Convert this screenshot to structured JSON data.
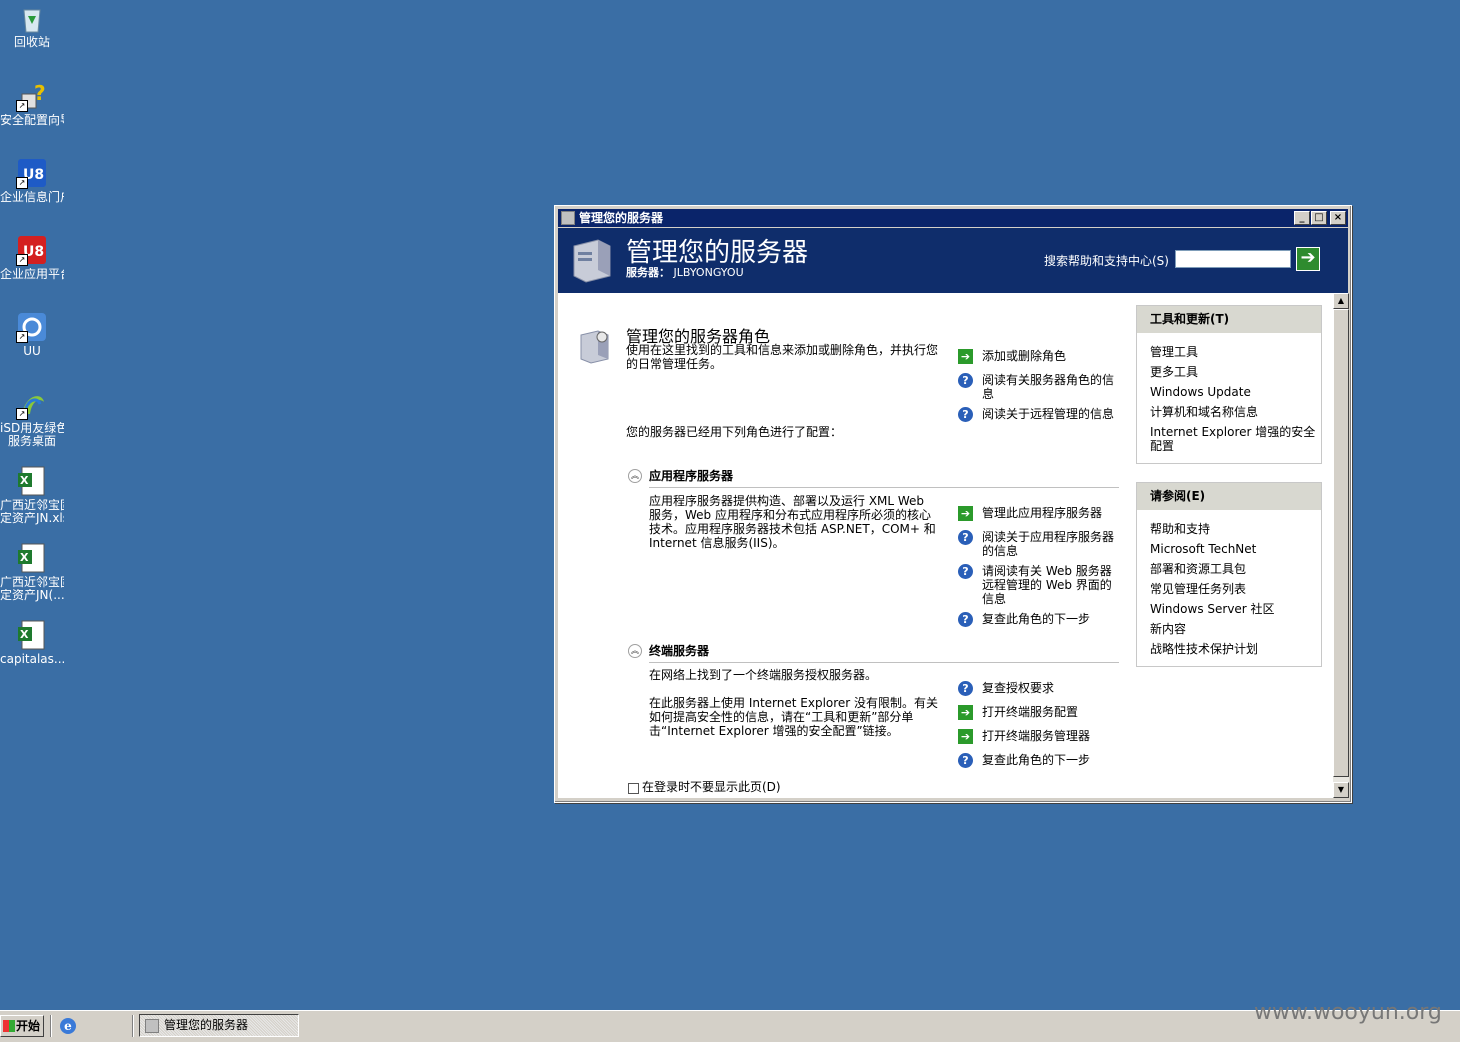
{
  "desktop": {
    "icons": [
      {
        "label1": "回收站",
        "label2": ""
      },
      {
        "label1": "安全配置向导",
        "label2": ""
      },
      {
        "label1": "企业信息门户",
        "label2": ""
      },
      {
        "label1": "企业应用平台",
        "label2": ""
      },
      {
        "label1": "UU",
        "label2": ""
      },
      {
        "label1": "iSD用友绿色",
        "label2": "服务桌面"
      },
      {
        "label1": "广西近邻宝固",
        "label2": "定资产JN.xls"
      },
      {
        "label1": "广西近邻宝固",
        "label2": "定资产JN(..."
      },
      {
        "label1": "capitalas...",
        "label2": ""
      }
    ]
  },
  "window": {
    "title": "管理您的服务器",
    "banner_title": "管理您的服务器",
    "server_label": "服务器：",
    "server_name": "JLBYONGYOU",
    "search_label": "搜索帮助和支持中心(S)",
    "search_value": ""
  },
  "main": {
    "heading": "管理您的服务器角色",
    "intro": "使用在这里找到的工具和信息来添加或删除角色，并执行您的日常管理任务。",
    "top_actions": [
      "添加或删除角色",
      "阅读有关服务器角色的信息",
      "阅读关于远程管理的信息"
    ],
    "configured_text": "您的服务器已经用下列角色进行了配置：",
    "roles": [
      {
        "name": "应用程序服务器",
        "desc": "应用程序服务器提供构造、部署以及运行 XML Web 服务，Web 应用程序和分布式应用程序所必须的核心技术。应用程序服务器技术包括 ASP.NET，COM+ 和 Internet 信息服务(IIS)。",
        "actions": [
          "管理此应用程序服务器",
          "阅读关于应用程序服务器的信息",
          "请阅读有关 Web 服务器远程管理的 Web 界面的信息",
          "复查此角色的下一步"
        ]
      },
      {
        "name": "终端服务器",
        "desc1": "在网络上找到了一个终端服务授权服务器。",
        "desc2": "在此服务器上使用 Internet Explorer 没有限制。有关如何提高安全性的信息，请在“工具和更新”部分单击“Internet Explorer 增强的安全配置”链接。",
        "actions": [
          "复查授权要求",
          "打开终端服务配置",
          "打开终端服务管理器",
          "复查此角色的下一步"
        ]
      }
    ],
    "dont_show": "在登录时不要显示此页(D)"
  },
  "sidebar": {
    "tools": {
      "title": "工具和更新(T)",
      "items": [
        "管理工具",
        "更多工具",
        "Windows Update",
        "计算机和域名称信息",
        "Internet Explorer 增强的安全配置"
      ]
    },
    "see_also": {
      "title": "请参阅(E)",
      "items": [
        "帮助和支持",
        "Microsoft TechNet",
        "部署和资源工具包",
        "常见管理任务列表",
        "Windows Server 社区",
        "新内容",
        "战略性技术保护计划"
      ]
    }
  },
  "taskbar": {
    "start": "开始",
    "task": "管理您的服务器"
  },
  "watermark": "www.wooyun.org"
}
